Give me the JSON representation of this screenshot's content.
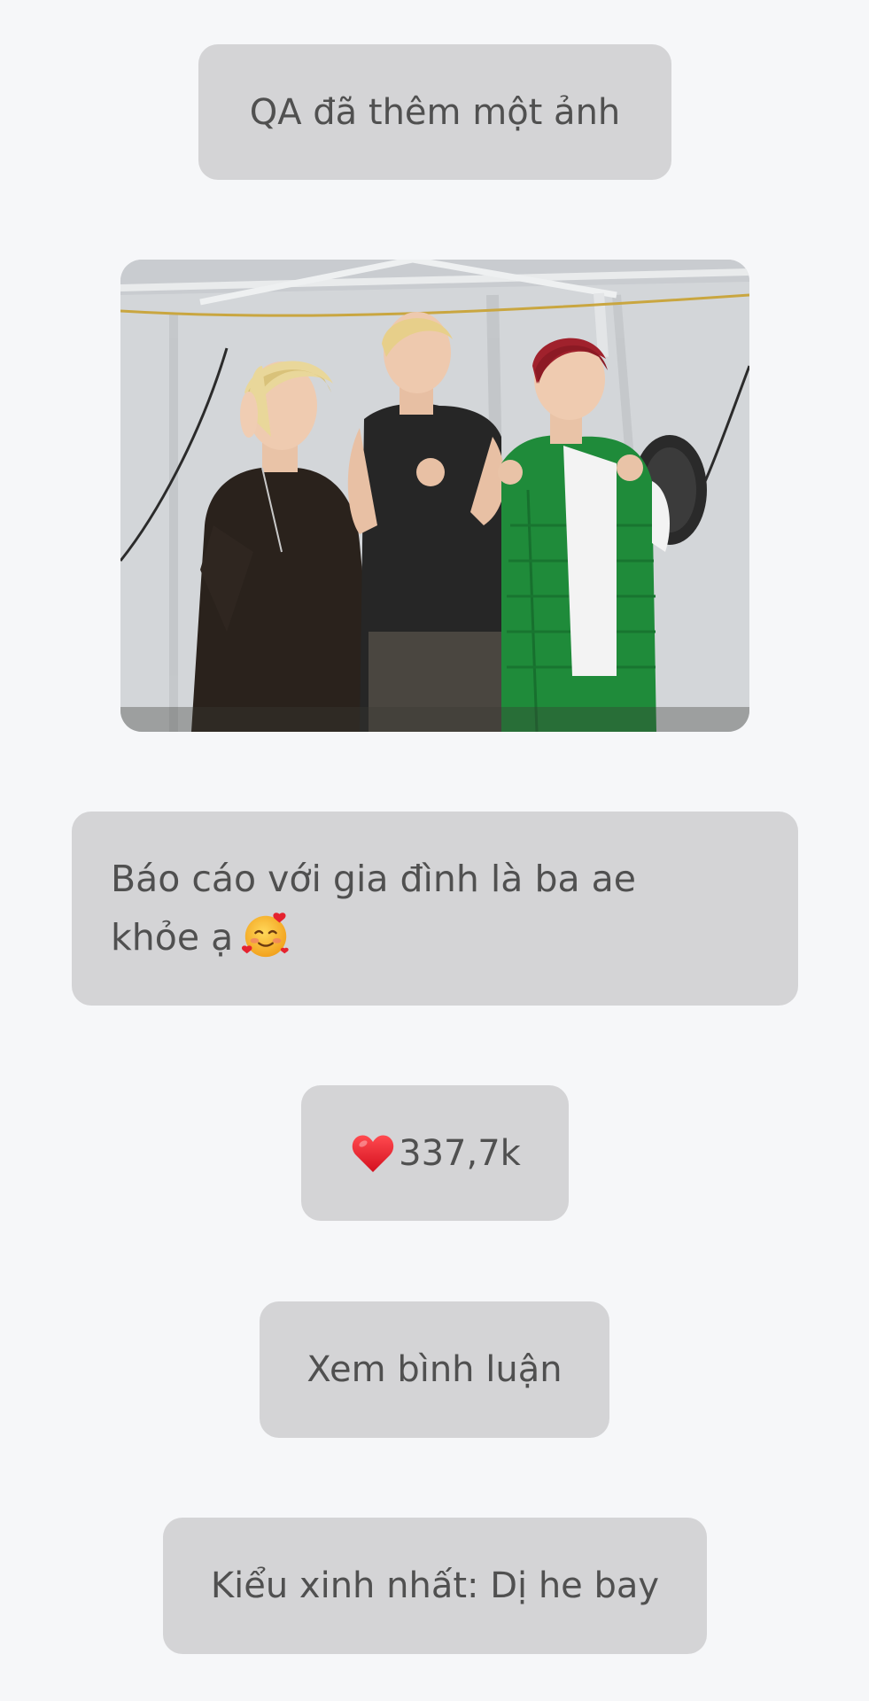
{
  "status": {
    "text": "QA đã thêm một ảnh"
  },
  "post": {
    "caption_line1": "Báo cáo với gia đình là ba ae",
    "caption_line2": "khỏe ạ",
    "caption_emoji": "smiling-face-with-hearts-icon",
    "image_icon": "group-photo"
  },
  "reactions": {
    "icon": "heart-icon",
    "count": "337,7k"
  },
  "comments_button": {
    "label": "Xem bình luận"
  },
  "top_comment": {
    "text": "Kiểu xinh nhất: Dị he bay"
  },
  "colors": {
    "background": "#f6f7f9",
    "bubble": "#d4d4d6",
    "text": "#505050",
    "heart": "#e0202c"
  }
}
